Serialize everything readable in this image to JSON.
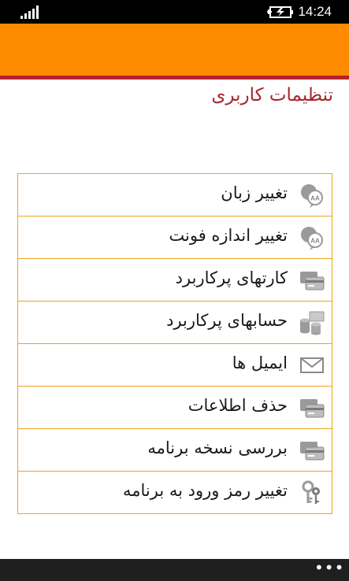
{
  "status_bar": {
    "time": "14:24",
    "icons": [
      "signal-strength-icon",
      "battery-charging-icon"
    ]
  },
  "colors": {
    "accent": "#ff8c00",
    "rule": "#b6232b",
    "title": "#a6272f",
    "item_border": "#f0a21a",
    "icon_gray": "#9a9a9a"
  },
  "page": {
    "title": "تنظیمات کاربری"
  },
  "menu": {
    "items": [
      {
        "label": "تغییر زبان",
        "icon": "chat-bubbles-icon"
      },
      {
        "label": "تغییر اندازه فونت",
        "icon": "chat-bubbles-icon"
      },
      {
        "label": "کارتهای پرکاربرد",
        "icon": "cards-icon"
      },
      {
        "label": "حسابهای پرکاربرد",
        "icon": "coins-icon"
      },
      {
        "label": "ایمیل ها",
        "icon": "envelope-icon"
      },
      {
        "label": "حذف اطلاعات",
        "icon": "cards-icon"
      },
      {
        "label": "بررسی نسخه برنامه",
        "icon": "cards-icon"
      },
      {
        "label": "تغییر رمز ورود به برنامه",
        "icon": "keys-icon"
      }
    ]
  },
  "app_bar": {
    "more_label": "•••"
  }
}
